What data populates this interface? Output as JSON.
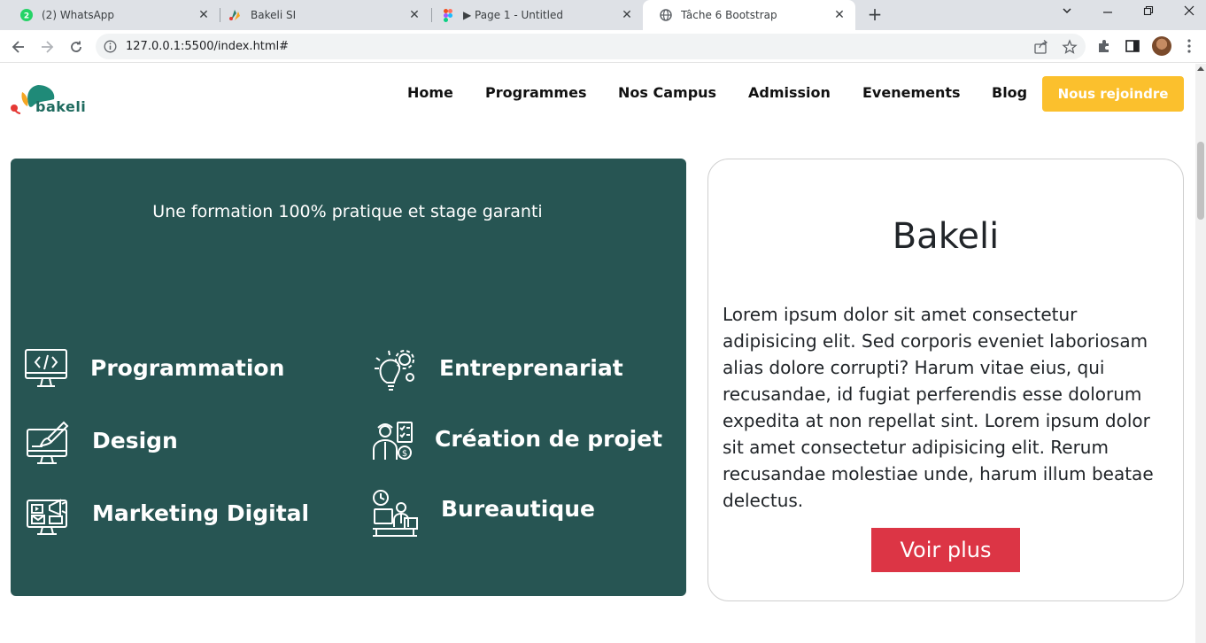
{
  "browser": {
    "tabs": [
      {
        "title": "(2) WhatsApp",
        "badge": "2",
        "active": false
      },
      {
        "title": "Bakeli SI",
        "active": false
      },
      {
        "title": "▶ Page 1 - Untitled",
        "active": false
      },
      {
        "title": "Tâche 6 Bootstrap",
        "active": true
      }
    ],
    "url": "127.0.0.1:5500/index.html#"
  },
  "site": {
    "logo_text": "bakeli",
    "nav": [
      "Home",
      "Programmes",
      "Nos Campus",
      "Admission",
      "Evenements",
      "Blog"
    ],
    "join_label": "Nous rejoindre",
    "colors": {
      "green": "#275553",
      "yellow": "#fbc02d",
      "red": "#dc3545"
    }
  },
  "green_card": {
    "tagline": "Une formation 100% pratique et stage garanti",
    "programs": [
      {
        "label": "Programmation",
        "icon": "code-monitor-icon"
      },
      {
        "label": "Entreprenariat",
        "icon": "idea-gears-icon"
      },
      {
        "label": "Design",
        "icon": "design-monitor-icon"
      },
      {
        "label": "Création de projet",
        "icon": "project-manager-icon"
      },
      {
        "label": "Marketing Digital",
        "icon": "digital-marketing-icon"
      },
      {
        "label": "Bureautique",
        "icon": "office-worker-icon"
      }
    ]
  },
  "white_card": {
    "title": "Bakeli",
    "text": "Lorem ipsum dolor sit amet consectetur adipisicing elit. Sed corporis eveniet laboriosam alias dolore corrupti? Harum vitae eius, qui recusandae, id fugiat perferendis esse dolorum expedita at non repellat sint. Lorem ipsum dolor sit amet consectetur adipisicing elit. Rerum recusandae molestiae unde, harum illum beatae delectus.",
    "button_label": "Voir plus"
  }
}
